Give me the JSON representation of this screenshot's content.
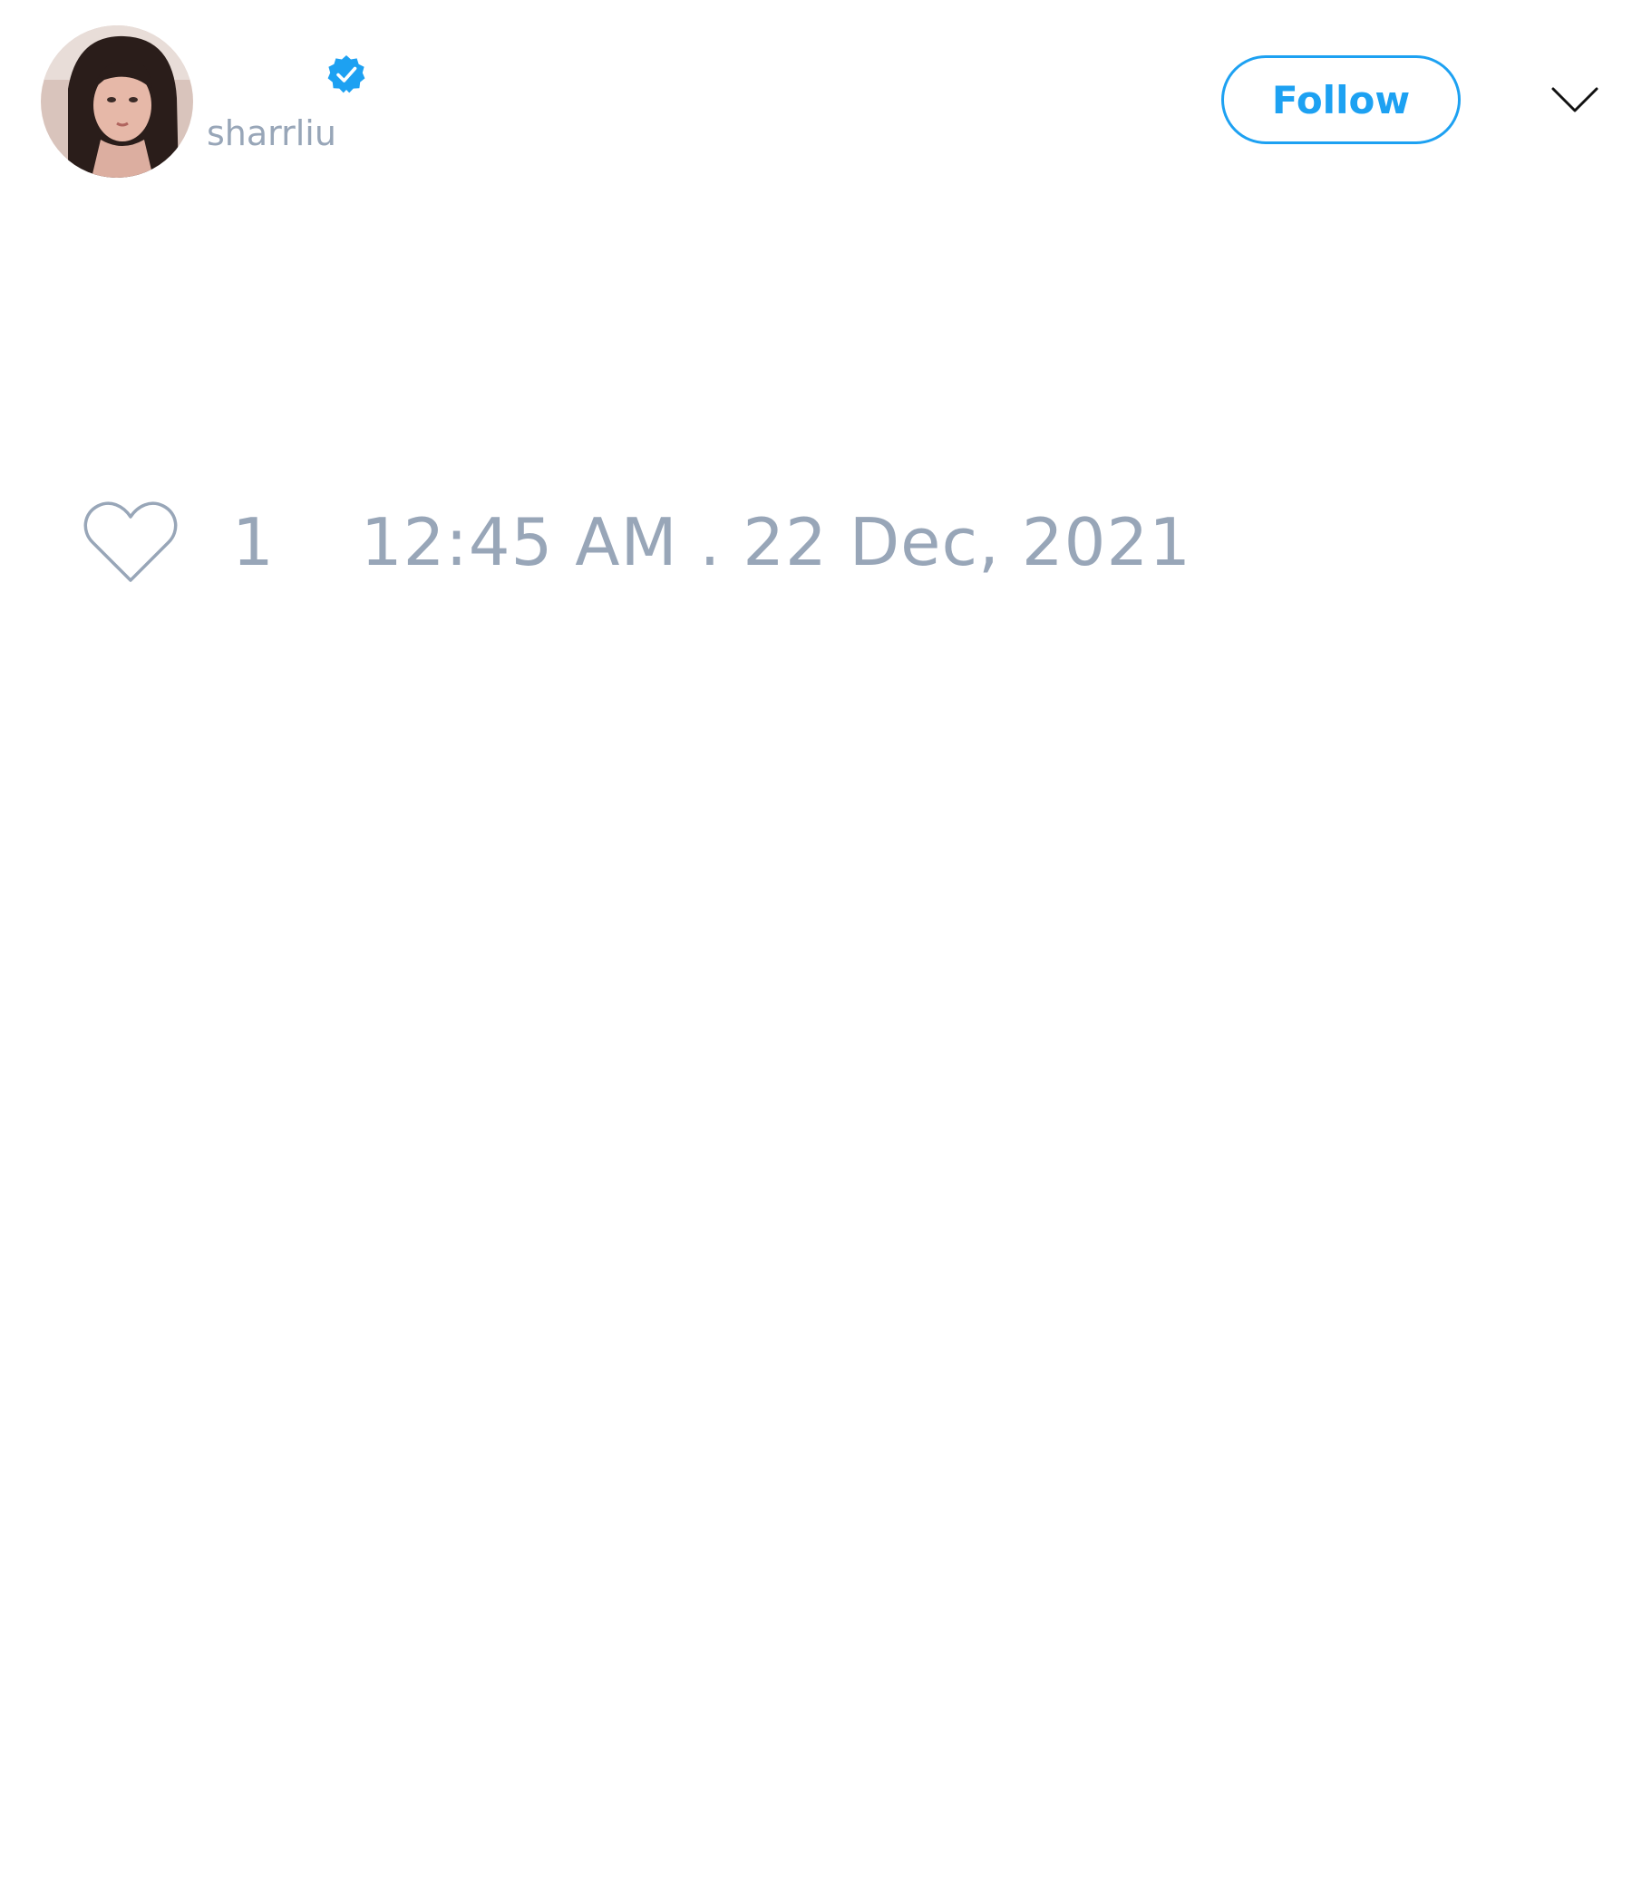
{
  "tweet": {
    "author": {
      "display_name": "",
      "handle": "sharrliu",
      "verified": true,
      "avatar_icon": "avatar-photo"
    },
    "follow_label": "Follow",
    "menu_icon": "chevron-down-icon",
    "likes": {
      "icon": "heart-icon",
      "count": "1"
    },
    "timestamp": "12:45 AM . 22 Dec, 2021"
  },
  "colors": {
    "accent": "#1da1f2",
    "muted_text": "#98a6b8",
    "background": "#ffffff"
  }
}
